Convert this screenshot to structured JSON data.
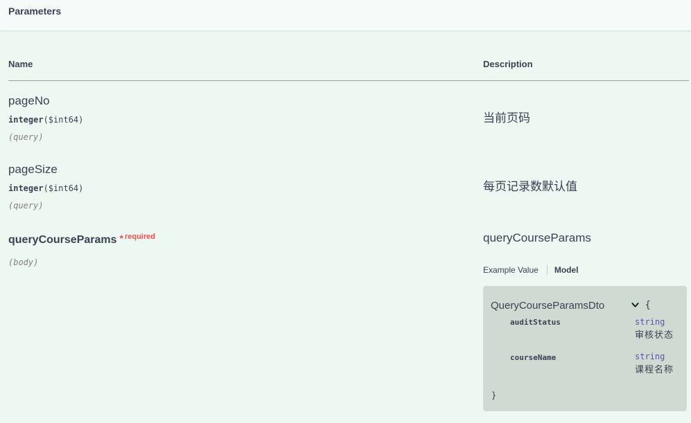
{
  "section": {
    "title": "Parameters"
  },
  "columns": {
    "name": "Name",
    "description": "Description"
  },
  "params": [
    {
      "name": "pageNo",
      "type": "integer",
      "format": "($int64)",
      "in": "(query)",
      "description": "当前页码"
    },
    {
      "name": "pageSize",
      "type": "integer",
      "format": "($int64)",
      "in": "(query)",
      "description": "每页记录数默认值"
    },
    {
      "name": "queryCourseParams",
      "required_star": "*",
      "required_label": "required",
      "in": "(body)",
      "description": "queryCourseParams"
    }
  ],
  "tabs": {
    "example": "Example Value",
    "model": "Model"
  },
  "model": {
    "title": "QueryCourseParamsDto",
    "open_brace": "{",
    "close_brace": "}",
    "properties": [
      {
        "name": "auditStatus",
        "type": "string",
        "description": "审核状态"
      },
      {
        "name": "courseName",
        "type": "string",
        "description": "课程名称"
      }
    ]
  }
}
